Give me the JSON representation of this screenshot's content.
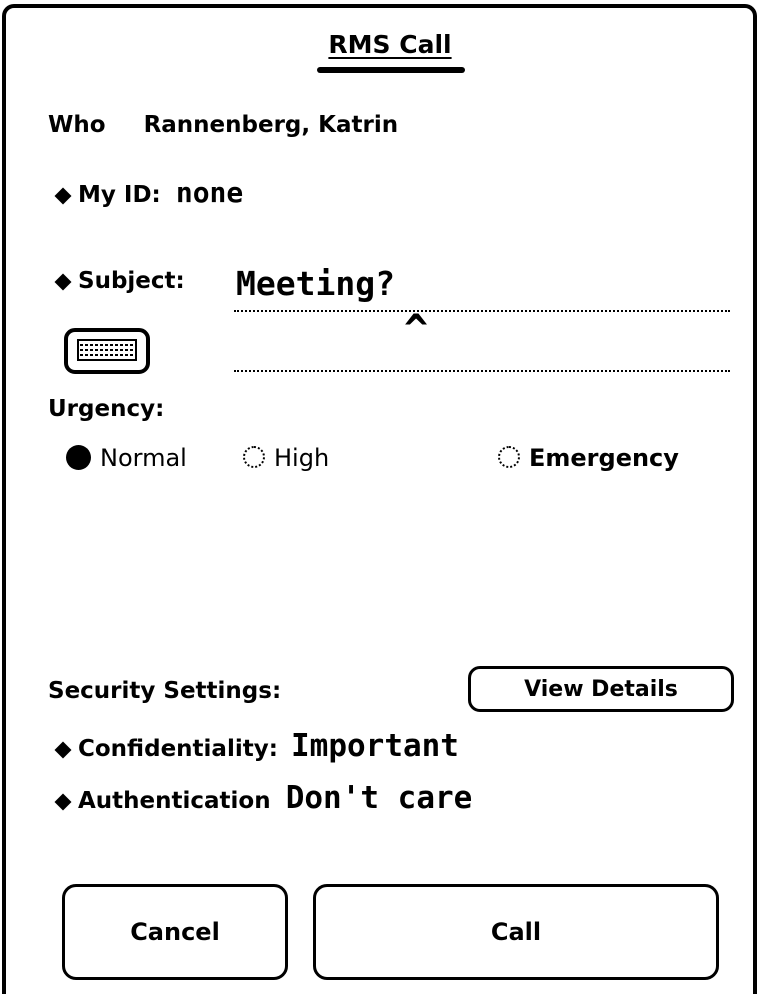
{
  "title": "RMS Call",
  "who": {
    "label": "Who",
    "value": "Rannenberg, Katrin"
  },
  "my_id": {
    "label": "My ID:",
    "value": "none"
  },
  "subject": {
    "label": "Subject:",
    "value": "Meeting?",
    "caret": "^"
  },
  "urgency": {
    "label": "Urgency:",
    "options": [
      "Normal",
      "High",
      "Emergency"
    ],
    "selected": "Normal"
  },
  "security": {
    "label": "Security Settings:",
    "details_button": "View Details",
    "confidentiality": {
      "label": "Confidentiality:",
      "value": "Important"
    },
    "authentication": {
      "label": "Authentication",
      "value": "Don't care"
    }
  },
  "buttons": {
    "cancel": "Cancel",
    "call": "Call"
  },
  "icons": {
    "keyboard": "keyboard-icon",
    "diamond": "diamond-bullet-icon",
    "radio": "radio-button-icon"
  }
}
